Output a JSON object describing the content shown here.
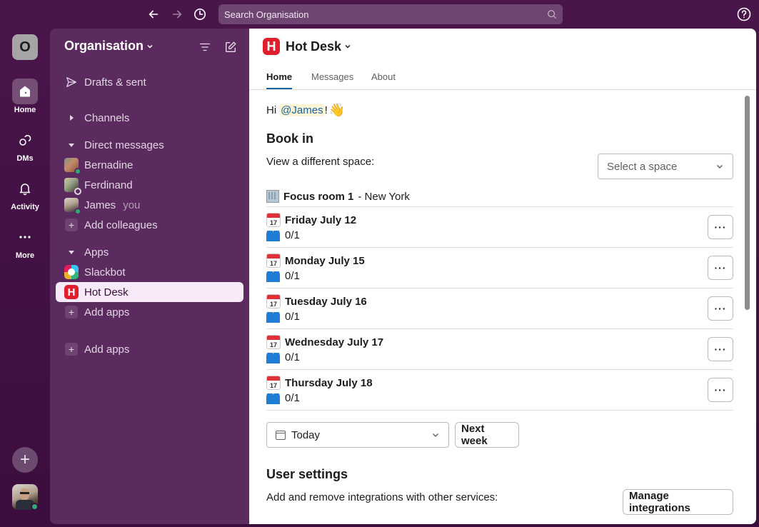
{
  "topbar": {
    "back_icon": "arrow-left-icon",
    "forward_icon": "arrow-right-icon",
    "history_icon": "clock-icon",
    "search_placeholder": "Search Organisation",
    "help_icon": "question-circle-icon"
  },
  "rail": {
    "workspace_initial": "O",
    "items": [
      {
        "label": "Home",
        "icon": "home-icon",
        "active": true
      },
      {
        "label": "DMs",
        "icon": "chat-bubbles-icon",
        "active": false
      },
      {
        "label": "Activity",
        "icon": "bell-icon",
        "active": false
      },
      {
        "label": "More",
        "icon": "ellipsis-icon",
        "active": false
      }
    ],
    "add_label": "+"
  },
  "sidebar": {
    "workspace_name": "Organisation",
    "drafts_label": "Drafts & sent",
    "channels_label": "Channels",
    "dm_section_label": "Direct messages",
    "dms": [
      {
        "name": "Bernadine",
        "status": "active"
      },
      {
        "name": "Ferdinand",
        "status": "away"
      },
      {
        "name": "James",
        "suffix": "you",
        "status": "active"
      }
    ],
    "add_colleagues_label": "Add colleagues",
    "apps_section_label": "Apps",
    "apps": [
      {
        "name": "Slackbot"
      },
      {
        "name": "Hot Desk",
        "active": true
      }
    ],
    "add_apps_label": "Add apps",
    "add_apps_label_2": "Add apps"
  },
  "main": {
    "app_title": "Hot Desk",
    "app_logo_letter": "H",
    "tabs": [
      {
        "label": "Home",
        "active": true
      },
      {
        "label": "Messages",
        "active": false
      },
      {
        "label": "About",
        "active": false
      }
    ],
    "greeting_prefix": "Hi",
    "greeting_mention": "@James",
    "greeting_suffix": "!",
    "greeting_emoji": "👋",
    "book_in_title": "Book in",
    "view_space_label": "View a different space:",
    "space_select_placeholder": "Select a space",
    "room_name": "Focus room 1",
    "room_location": "- New York",
    "days": [
      {
        "label": "Friday July 12",
        "occupancy": "0/1",
        "cal_day": "17"
      },
      {
        "label": "Monday July 15",
        "occupancy": "0/1",
        "cal_day": "17"
      },
      {
        "label": "Tuesday July 16",
        "occupancy": "0/1",
        "cal_day": "17"
      },
      {
        "label": "Wednesday July 17",
        "occupancy": "0/1",
        "cal_day": "17"
      },
      {
        "label": "Thursday July 18",
        "occupancy": "0/1",
        "cal_day": "17"
      }
    ],
    "overflow_label": "···",
    "date_picker_value": "Today",
    "next_week_label": "Next week",
    "user_settings_title": "User settings",
    "integrations_text": "Add and remove integrations with other services:",
    "manage_integrations_label": "Manage integrations"
  },
  "colors": {
    "aubergine": "#4a154b",
    "sidebar": "#5b2a5e",
    "active_item_bg": "#f8eaf8",
    "link_blue": "#1264a3",
    "presence_green": "#2bac76",
    "hotdesk_red": "#e01e2c"
  }
}
